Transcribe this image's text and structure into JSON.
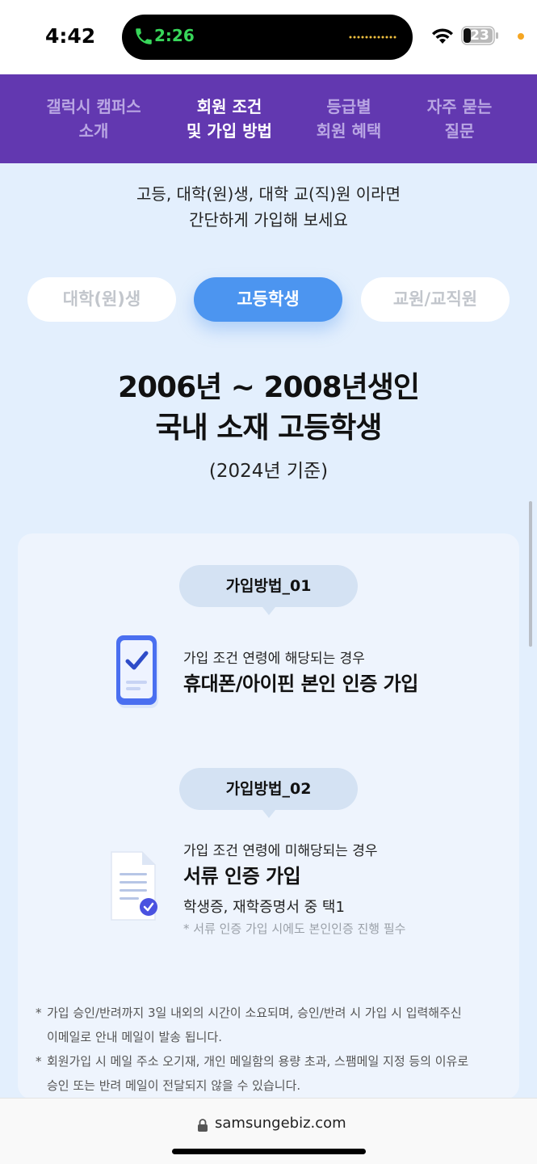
{
  "status": {
    "time": "4:42",
    "call_time": "2:26",
    "battery": "23"
  },
  "nav": {
    "items": [
      {
        "line1": "갤럭시 캠퍼스",
        "line2": "소개"
      },
      {
        "line1": "회원 조건",
        "line2": "및 가입 방법"
      },
      {
        "line1": "등급별",
        "line2": "회원 혜택"
      },
      {
        "line1": "자주 묻는",
        "line2": "질문"
      }
    ]
  },
  "intro": {
    "line1": "고등, 대학(원)생, 대학 교(직)원 이라면",
    "line2": "간단하게 가입해 보세요"
  },
  "tabs": [
    "대학(원)생",
    "고등학생",
    "교원/교직원"
  ],
  "headline": {
    "line1": "2006년 ~ 2008년생인",
    "line2": "국내 소재 고등학생",
    "basis": "(2024년 기준)"
  },
  "methods": [
    {
      "label": "가입방법_01",
      "subtitle": "가입 조건 연령에 해당되는 경우",
      "title": "휴대폰/아이핀 본인 인증 가입"
    },
    {
      "label": "가입방법_02",
      "subtitle": "가입 조건 연령에 미해당되는 경우",
      "title": "서류 인증 가입",
      "extra": "학생증, 재학증명서 중 택1",
      "note": "* 서류 인증 가입 시에도 본인인증 진행 필수"
    }
  ],
  "notes": [
    {
      "star": "*",
      "line1": "가입 승인/반려까지 3일 내외의 시간이 소요되며, 승인/반려 시 가입 시 입력해주신",
      "line2": "이메일로 안내 메일이 발송 됩니다."
    },
    {
      "star": "*",
      "line1": "회원가입 시 메일 주소 오기재, 개인 메일함의 용량 초과, 스팸메일 지정 등의 이유로",
      "line2": "승인 또는 반려 메일이 전달되지 않을 수 있습니다."
    }
  ],
  "browser": {
    "url": "samsungebiz.com"
  },
  "icons": {
    "call": "phone-call-icon",
    "wifi": "wifi-icon",
    "battery": "battery-icon",
    "lock": "lock-icon",
    "phone_check": "phone-check-icon",
    "document": "document-check-icon"
  },
  "colors": {
    "nav_bg": "#6238b0",
    "accent": "#4c95f0",
    "page_bg": "#e3effd"
  }
}
